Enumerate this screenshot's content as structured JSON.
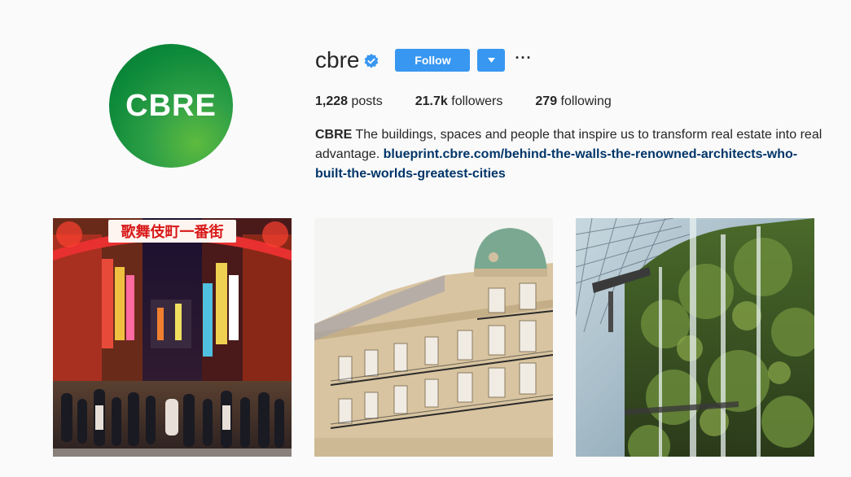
{
  "profile": {
    "username": "cbre",
    "avatar_text": "CBRE",
    "verified_icon": "verified-badge-icon",
    "follow_label": "Follow",
    "dropdown_icon": "caret-down-icon",
    "more_label": "···"
  },
  "stats": {
    "posts_count": "1,228",
    "posts_label": "posts",
    "followers_count": "21.7k",
    "followers_label": "followers",
    "following_count": "279",
    "following_label": "following"
  },
  "bio": {
    "name": "CBRE",
    "text": "The buildings, spaces and people that inspire us to transform real estate into real advantage.",
    "link_line1": "blueprint.cbre.com/behind-the-walls-the-renowned-architects-who-",
    "link_line2": "built-the-worlds-greatest-cities"
  },
  "posts": {
    "sign_text": "歌舞伎町一番街"
  },
  "colors": {
    "accent": "#3897f0",
    "link": "#003569",
    "background": "#fafafa",
    "avatar_green": "#0d8a3a"
  }
}
